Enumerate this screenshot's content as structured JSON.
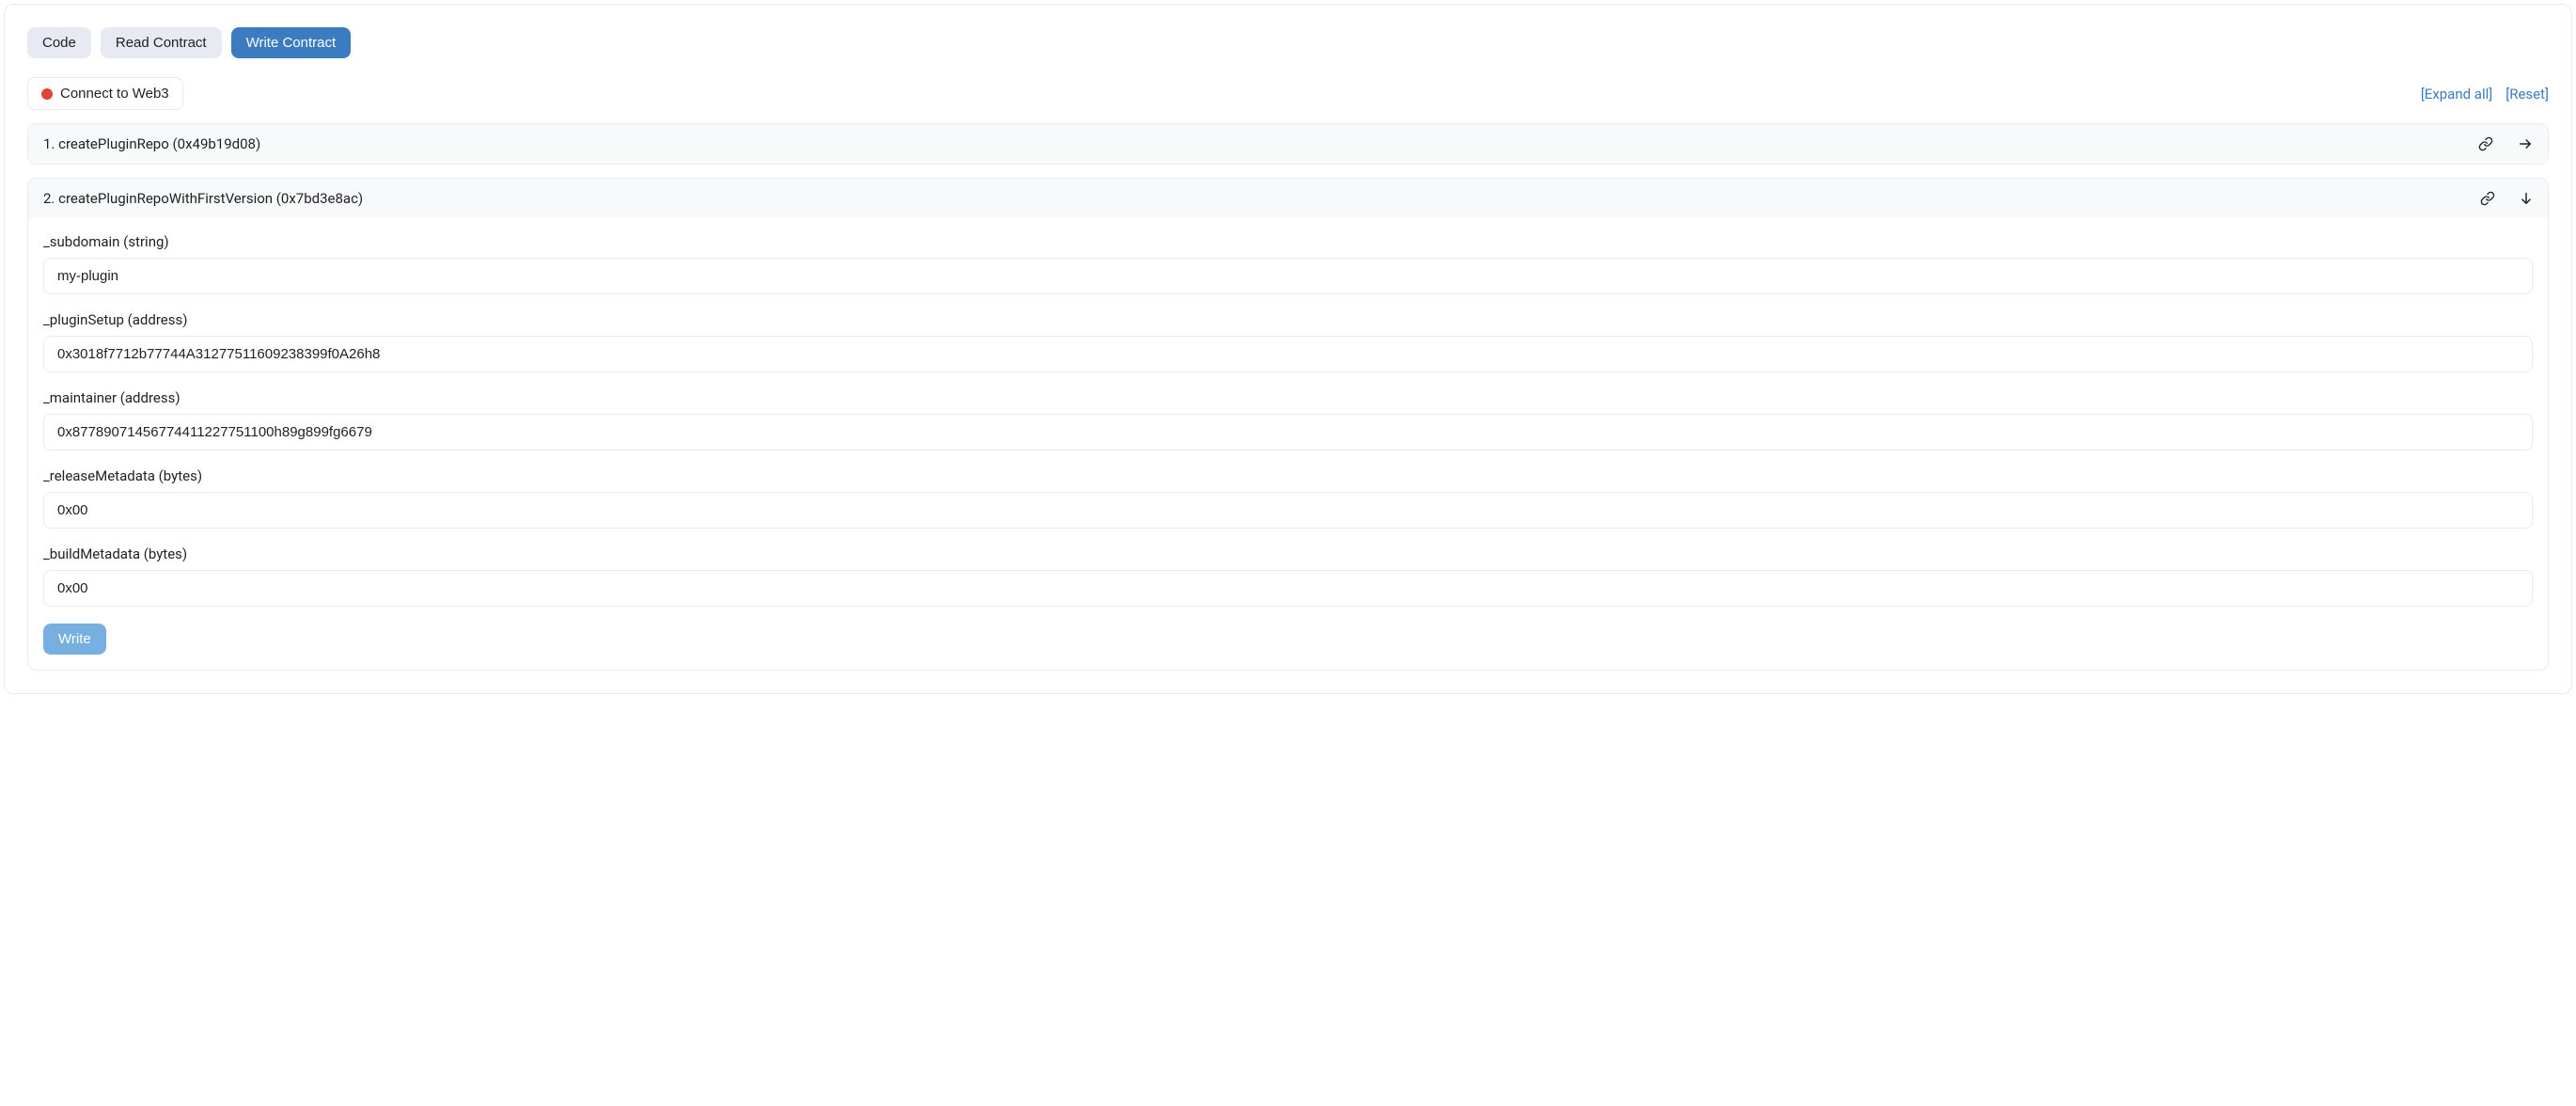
{
  "tabs": {
    "code": "Code",
    "read": "Read Contract",
    "write": "Write Contract"
  },
  "toolbar": {
    "connect": "Connect to Web3",
    "expand_all": "[Expand all]",
    "reset": "[Reset]"
  },
  "methods": [
    {
      "title": "1. createPluginRepo (0x49b19d08)",
      "expanded": false
    },
    {
      "title": "2. createPluginRepoWithFirstVersion (0x7bd3e8ac)",
      "expanded": true,
      "fields": [
        {
          "label": "_subdomain (string)",
          "value": "my-plugin"
        },
        {
          "label": "_pluginSetup (address)",
          "value": "0x3018f7712b77744A31277511609238399f0A26h8"
        },
        {
          "label": "_maintainer (address)",
          "value": "0x87789071456774411227751100h89g899fg6679"
        },
        {
          "label": "_releaseMetadata (bytes)",
          "value": "0x00"
        },
        {
          "label": "_buildMetadata (bytes)",
          "value": "0x00"
        }
      ],
      "write_label": "Write"
    }
  ]
}
